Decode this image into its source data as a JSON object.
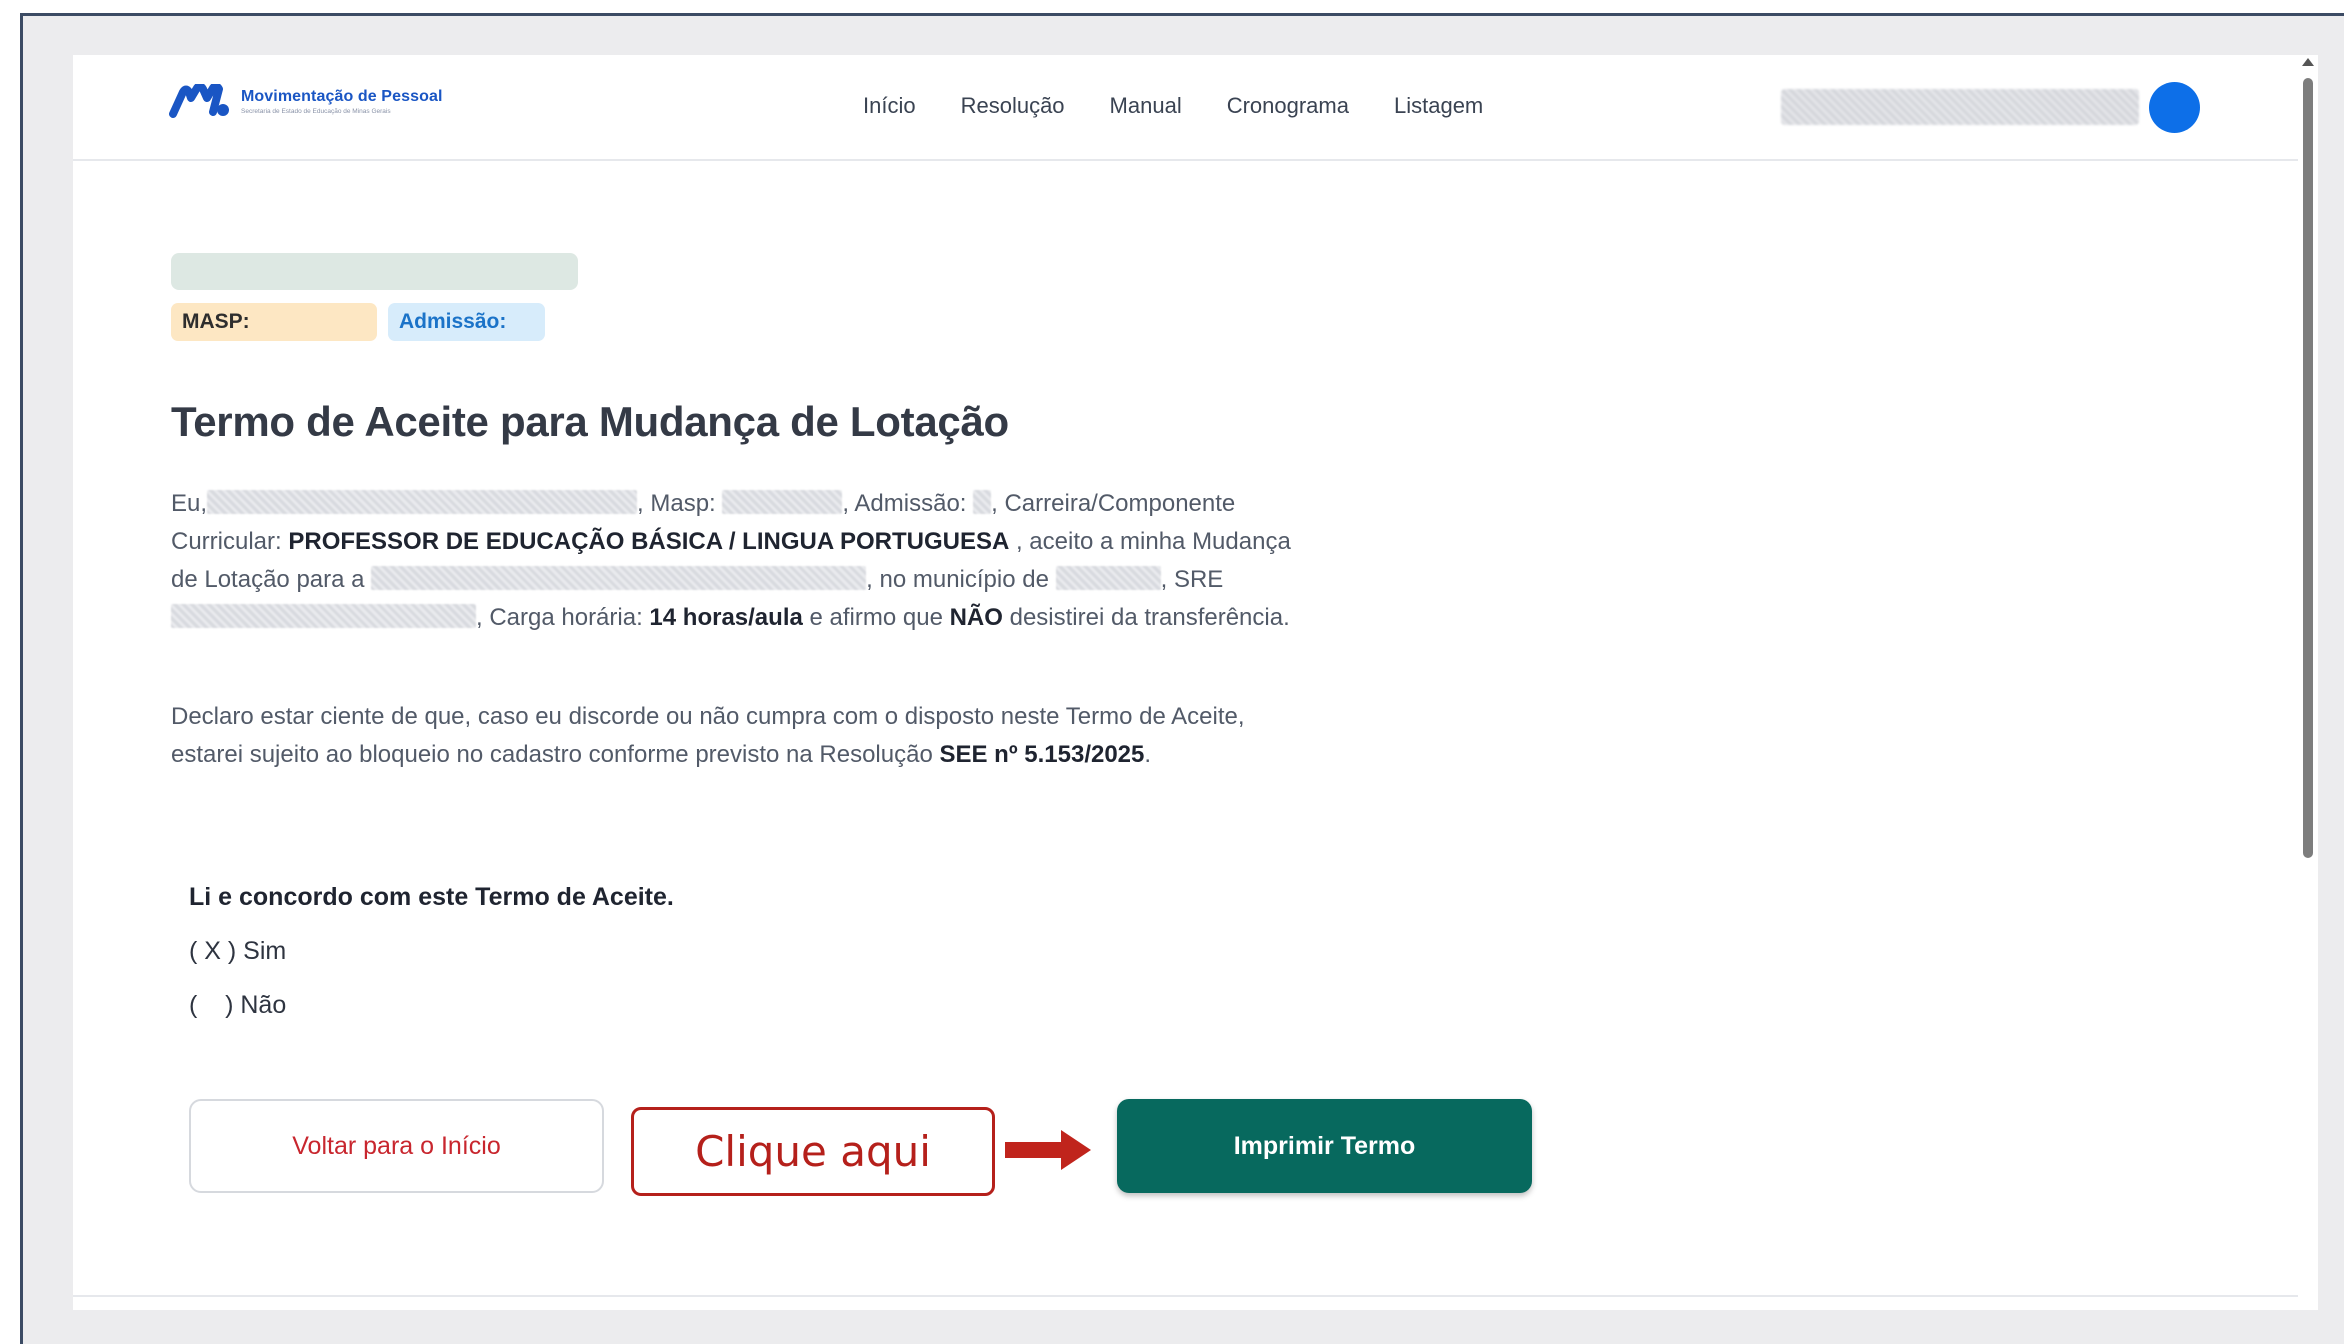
{
  "header": {
    "logo_title": "Movimentação de Pessoal",
    "logo_subtitle": "Secretaria de Estado de Educação de Minas Gerais",
    "nav": [
      "Início",
      "Resolução",
      "Manual",
      "Cronograma",
      "Listagem"
    ]
  },
  "badges": {
    "masp": "MASP:",
    "admissao": "Admissão:"
  },
  "title": "Termo de Aceite para Mudança de Lotação",
  "paragraph1": {
    "eu": "Eu,",
    "masp": ", Masp:",
    "admissao": ", Admissão:",
    "carreira": ", Carreira/Componente Curricular:",
    "cargo": "PROFESSOR DE EDUCAÇÃO BÁSICA / LINGUA PORTUGUESA",
    "aceito": ", aceito a minha Mudança de Lotação para a",
    "municipio": ", no município de",
    "sre": ", SRE",
    "carga": ", Carga horária:",
    "horas": "14 horas/aula",
    "afirmo": "e afirmo que",
    "nao": "NÃO",
    "desistirei": "desistirei da transferência."
  },
  "paragraph2": {
    "text": "Declaro estar ciente de que, caso eu discorde ou não cumpra com o disposto neste Termo de Aceite, estarei sujeito ao bloqueio no cadastro conforme previsto na Resolução",
    "resolucao": "SEE nº 5.153/2025",
    "end": "."
  },
  "agreement": {
    "title": "Li e concordo com este Termo de Aceite.",
    "option_yes": "( X ) Sim",
    "option_no": "(    ) Não"
  },
  "buttons": {
    "back": "Voltar para o Início",
    "print": "Imprimir Termo"
  },
  "callout": "Clique aqui",
  "colors": {
    "primary": "#07695e",
    "danger": "#c8262e",
    "callout": "#b5201b",
    "avatar": "#0d6fe8"
  }
}
